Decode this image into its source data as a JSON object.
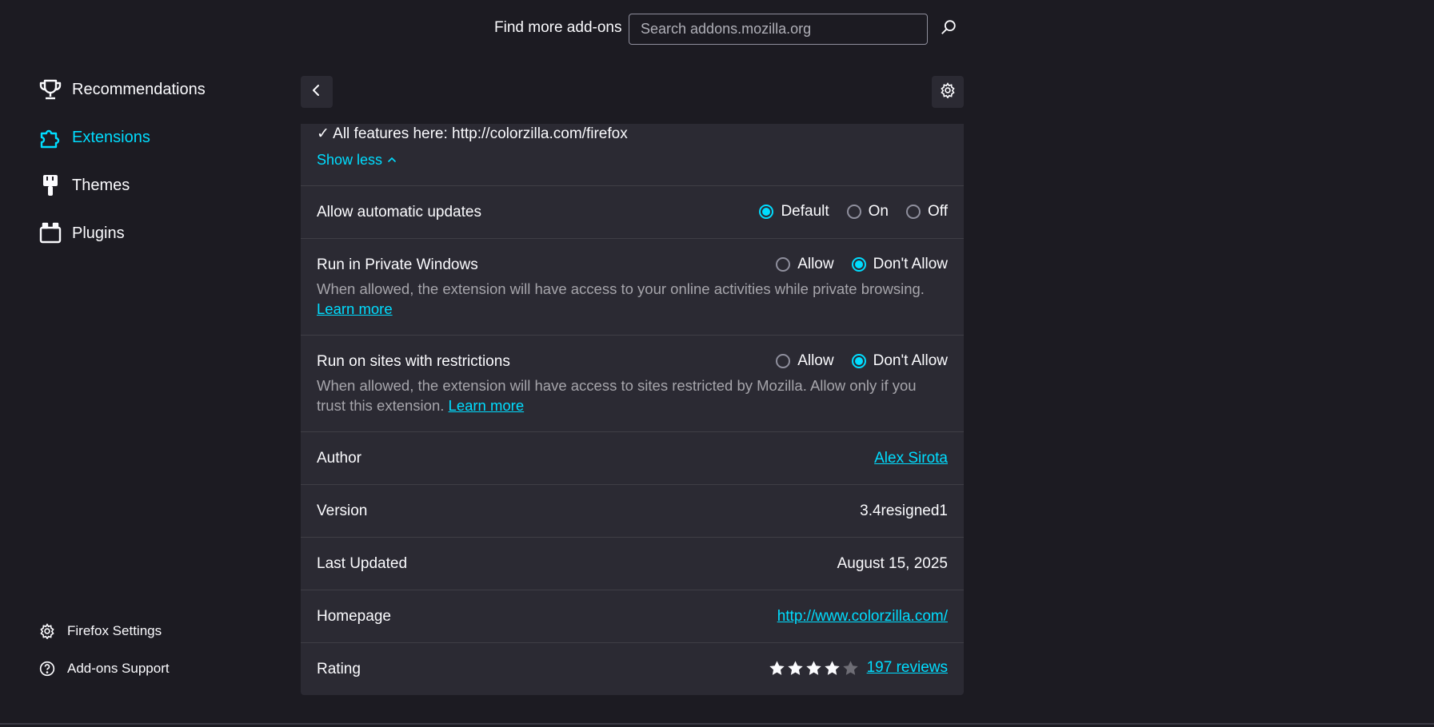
{
  "sidebar": {
    "items": [
      {
        "label": "Recommendations",
        "icon": "trophy-icon"
      },
      {
        "label": "Extensions",
        "icon": "puzzle-icon",
        "active": true
      },
      {
        "label": "Themes",
        "icon": "brush-icon"
      },
      {
        "label": "Plugins",
        "icon": "plugin-icon"
      }
    ],
    "footer": [
      {
        "label": "Firefox Settings",
        "icon": "gear-icon"
      },
      {
        "label": "Add-ons Support",
        "icon": "help-icon"
      }
    ]
  },
  "search": {
    "label": "Find more add-ons",
    "placeholder": "Search addons.mozilla.org"
  },
  "details": {
    "feature_line": "✓ All features here: http://colorzilla.com/firefox",
    "show_less": "Show less",
    "auto_updates": {
      "title": "Allow automatic updates",
      "options": [
        "Default",
        "On",
        "Off"
      ],
      "selected": "Default"
    },
    "private_windows": {
      "title": "Run in Private Windows",
      "options": [
        "Allow",
        "Don't Allow"
      ],
      "selected": "Don't Allow",
      "description": "When allowed, the extension will have access to your online activities while private browsing.",
      "learn_more": "Learn more"
    },
    "restricted_sites": {
      "title": "Run on sites with restrictions",
      "options": [
        "Allow",
        "Don't Allow"
      ],
      "selected": "Don't Allow",
      "description": "When allowed, the extension will have access to sites restricted by Mozilla. Allow only if you trust this extension.",
      "learn_more": "Learn more"
    },
    "author": {
      "label": "Author",
      "value": "Alex Sirota"
    },
    "version": {
      "label": "Version",
      "value": "3.4resigned1"
    },
    "last_updated": {
      "label": "Last Updated",
      "value": "August 15, 2025"
    },
    "homepage": {
      "label": "Homepage",
      "value": "http://www.colorzilla.com/"
    },
    "rating": {
      "label": "Rating",
      "stars": 4,
      "max_stars": 5,
      "reviews": "197 reviews"
    }
  },
  "colors": {
    "background": "#1c1b22",
    "card": "#2b2a33",
    "accent": "#00ddff",
    "text": "#fbfbfe",
    "muted": "#a6a5ab"
  }
}
